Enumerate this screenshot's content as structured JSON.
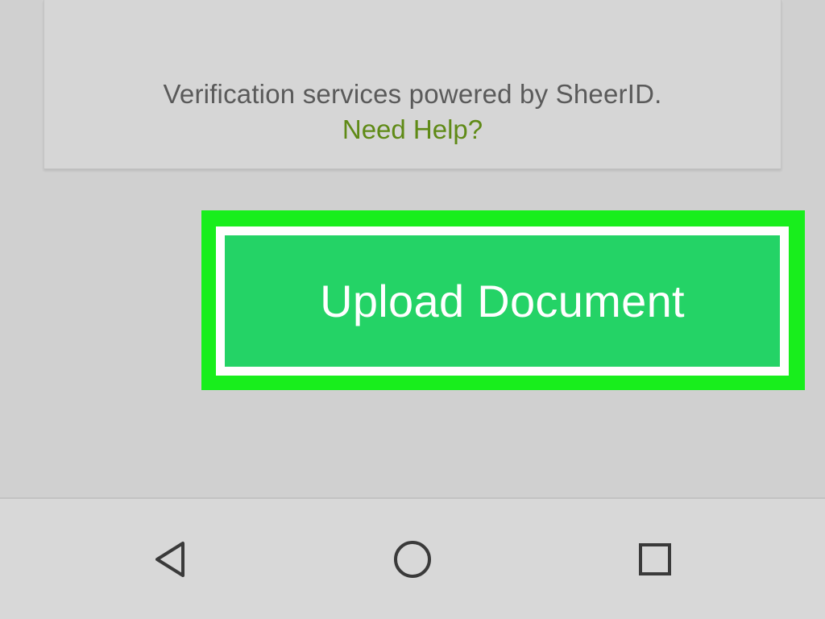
{
  "card": {
    "powered_by": "Verification services powered by SheerID.",
    "help_link": "Need Help?"
  },
  "upload_button": {
    "label": "Upload Document"
  },
  "colors": {
    "highlight": "#18ee1c",
    "button": "#24d366",
    "help_link": "#5f8a16"
  },
  "nav_bar": {
    "icons": [
      "back-icon",
      "home-icon",
      "recent-apps-icon"
    ]
  }
}
